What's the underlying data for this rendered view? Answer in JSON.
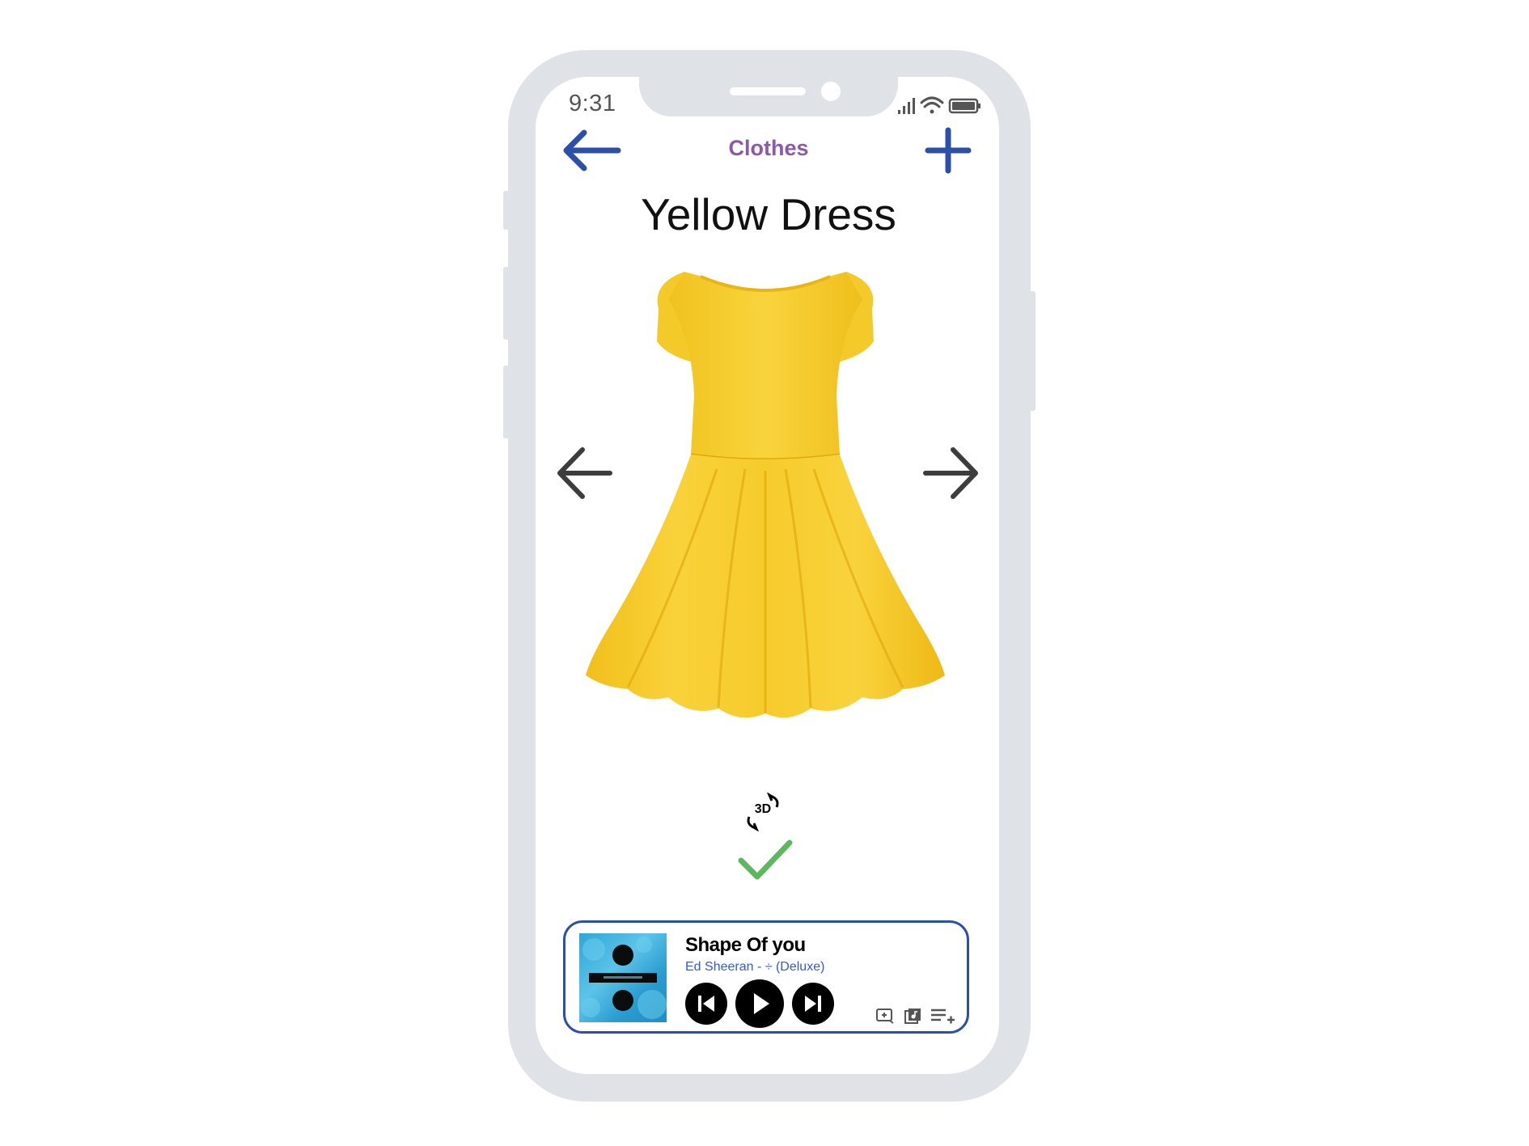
{
  "status_bar": {
    "time": "9:31",
    "icons": [
      "signal-icon",
      "wifi-icon",
      "battery-icon"
    ]
  },
  "nav": {
    "title": "Clothes",
    "back_icon": "arrow-left-icon",
    "add_icon": "plus-icon"
  },
  "item": {
    "title": "Yellow Dress",
    "image": "yellow-dress-image",
    "view_3d_label": "3D",
    "confirm_icon": "checkmark-icon"
  },
  "player": {
    "song_title": "Shape Of you",
    "artist_album": "Ed Sheeran - ÷ (Deluxe)",
    "album_art": "divide-album-art",
    "controls": [
      "skip-previous-icon",
      "play-icon",
      "skip-next-icon"
    ],
    "tools": [
      "cast-icon",
      "library-icon",
      "queue-add-icon"
    ]
  },
  "colors": {
    "phone_frame": "#dfe2e6",
    "nav_icon": "#2c4faa",
    "nav_title": "#8e58a8",
    "confirm": "#5cb85c",
    "dress": "#f5c92a",
    "player_border": "#2c4faa",
    "artist_text": "#2d5be3"
  }
}
